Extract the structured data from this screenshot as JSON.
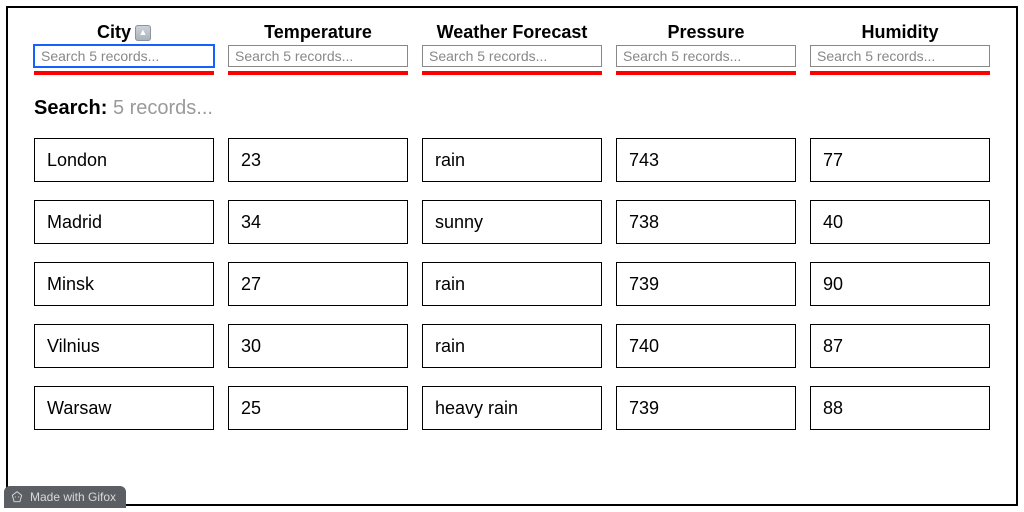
{
  "columns": [
    {
      "title": "City",
      "placeholder": "Search 5 records...",
      "sort": "asc"
    },
    {
      "title": "Temperature",
      "placeholder": "Search 5 records..."
    },
    {
      "title": "Weather Forecast",
      "placeholder": "Search 5 records..."
    },
    {
      "title": "Pressure",
      "placeholder": "Search 5 records..."
    },
    {
      "title": "Humidity",
      "placeholder": "Search 5 records..."
    }
  ],
  "search": {
    "label": "Search:",
    "value": "5 records..."
  },
  "rows": [
    {
      "city": "London",
      "temperature": "23",
      "forecast": "rain",
      "pressure": "743",
      "humidity": "77"
    },
    {
      "city": "Madrid",
      "temperature": "34",
      "forecast": "sunny",
      "pressure": "738",
      "humidity": "40"
    },
    {
      "city": "Minsk",
      "temperature": "27",
      "forecast": "rain",
      "pressure": "739",
      "humidity": "90"
    },
    {
      "city": "Vilnius",
      "temperature": "30",
      "forecast": "rain",
      "pressure": "740",
      "humidity": "87"
    },
    {
      "city": "Warsaw",
      "temperature": "25",
      "forecast": "heavy rain",
      "pressure": "739",
      "humidity": "88"
    }
  ],
  "watermark": "Made with Gifox"
}
